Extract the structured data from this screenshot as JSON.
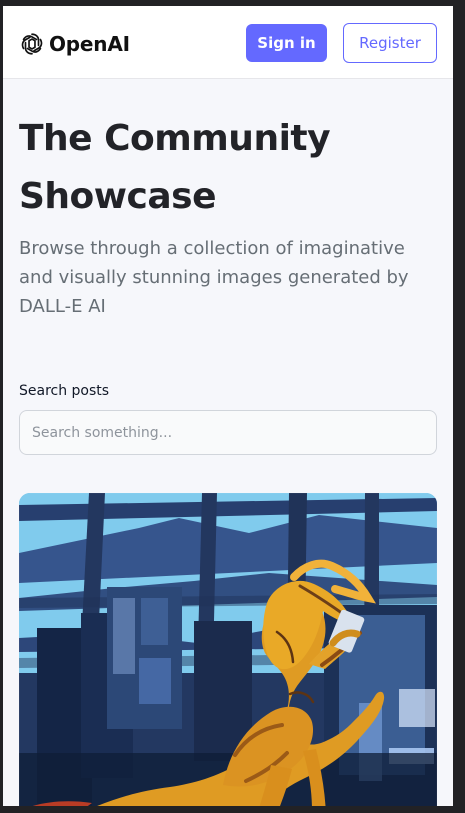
{
  "header": {
    "brand_name": "OpenAI",
    "logo_icon": "openai-knot-icon",
    "sign_in_label": "Sign in",
    "register_label": "Register"
  },
  "hero": {
    "title": "The Community Showcase",
    "subtitle": "Browse through a collection of imaginative and visually stunning images generated by DALL-E AI"
  },
  "search": {
    "label": "Search posts",
    "placeholder": "Search something...",
    "value": ""
  },
  "colors": {
    "accent": "#6469ff",
    "page_background": "#f6f7fb",
    "header_background": "#ffffff",
    "title_text": "#222328",
    "subtitle_text": "#666e75"
  },
  "gallery": {
    "posts": [
      {
        "image_subject": "orange dinosaur in a blue industrial room"
      }
    ]
  }
}
